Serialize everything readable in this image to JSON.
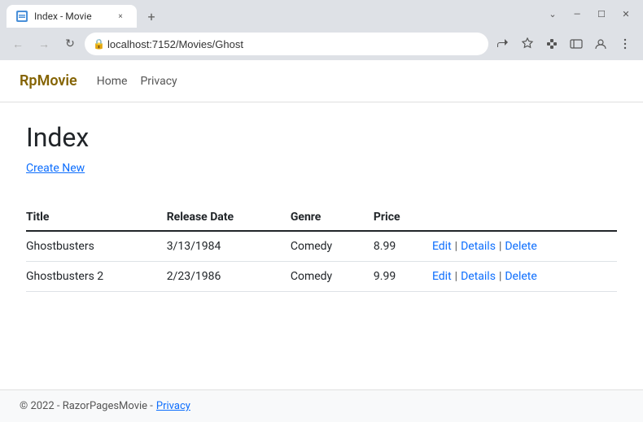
{
  "browser": {
    "tab": {
      "favicon_color": "#4a90d9",
      "title": "Index - Movie",
      "close_icon": "×"
    },
    "new_tab_icon": "+",
    "window_controls": {
      "chevron": "⌄",
      "minimize": "—",
      "maximize": "☐",
      "close": "✕"
    },
    "nav": {
      "back_icon": "←",
      "forward_icon": "→",
      "reload_icon": "↻",
      "lock_icon": "🔒",
      "url": "localhost:7152/Movies/Ghost"
    },
    "toolbar": {
      "share_icon": "⬆",
      "star_icon": "☆",
      "extension_icon": "🧩",
      "sidebar_icon": "▭",
      "profile_icon": "👤",
      "menu_icon": "⋮"
    }
  },
  "site": {
    "brand": "RpMovie",
    "nav_links": [
      {
        "label": "Home",
        "href": "/"
      },
      {
        "label": "Privacy",
        "href": "/Privacy"
      }
    ]
  },
  "page": {
    "title": "Index",
    "create_new_label": "Create New"
  },
  "table": {
    "columns": [
      "Title",
      "Release Date",
      "Genre",
      "Price"
    ],
    "rows": [
      {
        "title": "Ghostbusters",
        "release_date": "3/13/1984",
        "genre": "Comedy",
        "price": "8.99"
      },
      {
        "title": "Ghostbusters 2",
        "release_date": "2/23/1986",
        "genre": "Comedy",
        "price": "9.99"
      }
    ],
    "actions": [
      "Edit",
      "Details",
      "Delete"
    ]
  },
  "footer": {
    "copyright": "© 2022 - RazorPagesMovie -",
    "privacy_label": "Privacy"
  }
}
